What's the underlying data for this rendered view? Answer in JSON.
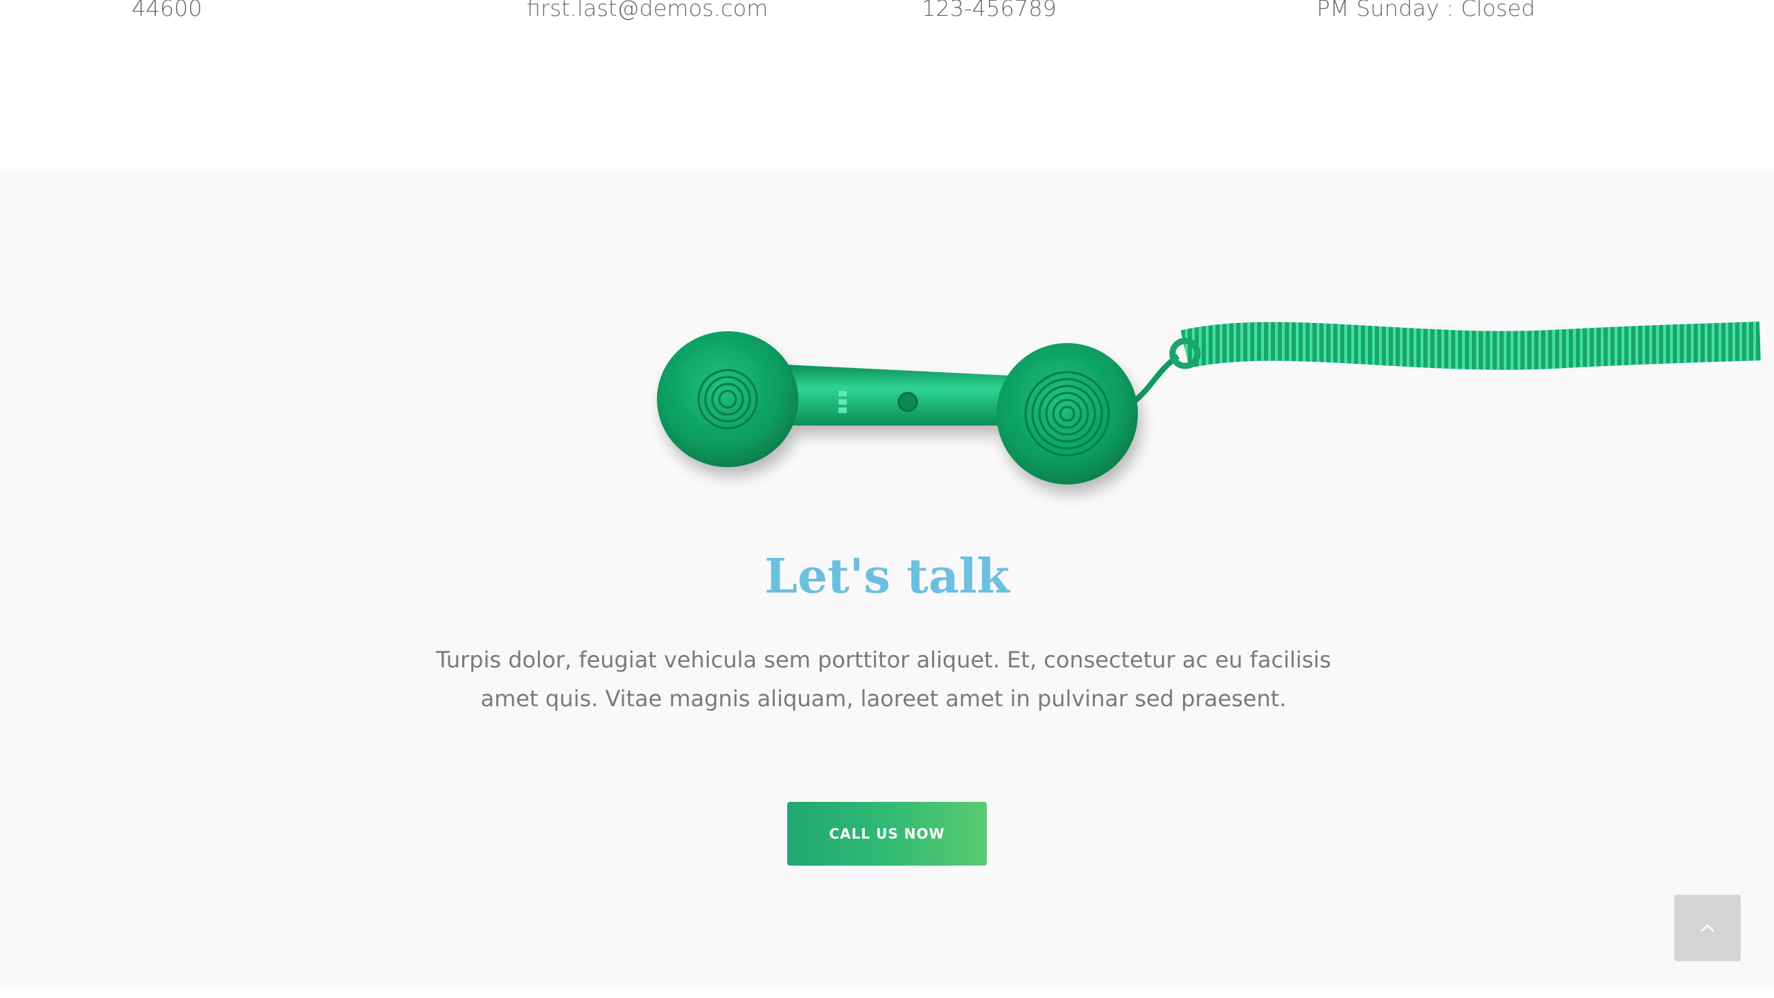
{
  "contact": {
    "address": "44600",
    "email": "first.last@demos.com",
    "phone": "123-456789",
    "hours": "PM Sunday : Closed"
  },
  "cta": {
    "title": "Let's talk",
    "text": "Turpis dolor, feugiat vehicula sem porttitor aliquet. Et, consectetur ac eu facilisis amet quis. Vitae magnis aliquam, laoreet amet in pulvinar sed praesent.",
    "button_label": "CALL US NOW",
    "image": "green-phone-handset-image"
  },
  "scroll_top": {
    "icon": "chevron-up-icon"
  },
  "colors": {
    "heading": "#6cbfdf",
    "button_start": "#22a872",
    "button_end": "#5acb72",
    "section_bg": "#f9f9f9",
    "phone_green": "#0ea36a"
  }
}
